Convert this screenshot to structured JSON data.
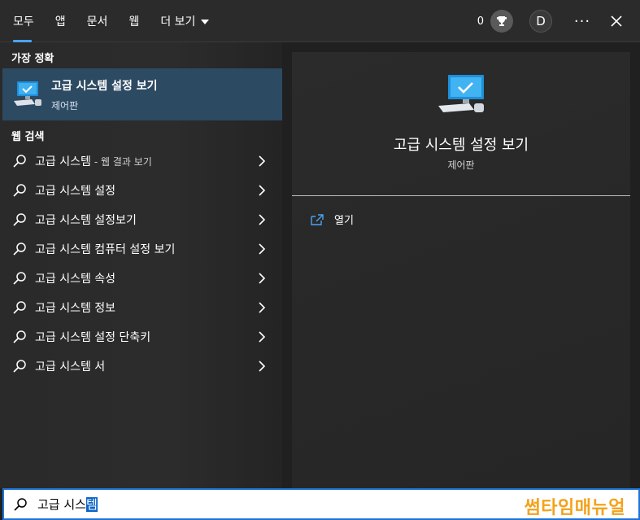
{
  "tabs": [
    {
      "label": "모두",
      "active": true
    },
    {
      "label": "앱"
    },
    {
      "label": "문서"
    },
    {
      "label": "웹"
    },
    {
      "label": "더 보기"
    }
  ],
  "top_right": {
    "points": "0",
    "avatar_initial": "D",
    "more_label": "···"
  },
  "best_match": {
    "section_label": "가장 정확",
    "title": "고급 시스템 설정 보기",
    "subtitle": "제어판",
    "icon": "computer-settings-icon"
  },
  "web_search": {
    "section_label": "웹 검색",
    "items": [
      {
        "text": "고급 시스템",
        "suffix": "- 웹 결과 보기"
      },
      {
        "text": "고급 시스템 설정"
      },
      {
        "text": "고급 시스템 설정보기"
      },
      {
        "text": "고급 시스템 컴퓨터 설정 보기"
      },
      {
        "text": "고급 시스템 속성"
      },
      {
        "text": "고급 시스템 정보"
      },
      {
        "text": "고급 시스템 설정 단축키"
      },
      {
        "text": "고급 시스템 서"
      }
    ]
  },
  "detail": {
    "title": "고급 시스템 설정 보기",
    "subtitle": "제어판",
    "actions": [
      {
        "label": "열기",
        "icon": "open-external-icon"
      }
    ]
  },
  "search": {
    "query_prefix": "고급 시스",
    "query_selected": "템"
  },
  "watermark": "썸타임매뉴얼",
  "colors": {
    "accent": "#4aa3f2",
    "selection": "#2d4a63",
    "watermark": "#f4a21a"
  }
}
